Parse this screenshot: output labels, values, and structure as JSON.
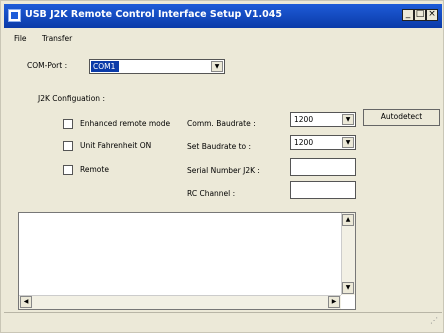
{
  "window": {
    "title": "USB J2K Remote Control Interface Setup V1.045",
    "minimize": "_",
    "maximize": "□",
    "close": "×"
  },
  "menu": {
    "file": "File",
    "transfer": "Transfer"
  },
  "com_port": {
    "label": "COM-Port :",
    "value": "COM1"
  },
  "j2k_config": {
    "label": "J2K Configuation :"
  },
  "checkboxes": {
    "enhanced": "Enhanced remote mode",
    "fahrenheit": "Unit Fahrenheit ON",
    "remote": "Remote"
  },
  "fields": {
    "comm_baud_label": "Comm.  Baudrate :",
    "comm_baud_value": "1200",
    "set_baud_label": "Set Baudrate to :",
    "set_baud_value": "1200",
    "serial_label": "Serial Number J2K :",
    "rc_channel_label": "RC Channel :"
  },
  "buttons": {
    "autodetect": "Autodetect"
  },
  "icons": {
    "dropdown": "▼",
    "scroll_up": "▲",
    "scroll_down": "▼",
    "scroll_left": "◀",
    "scroll_right": "▶",
    "grip": "⋰"
  }
}
